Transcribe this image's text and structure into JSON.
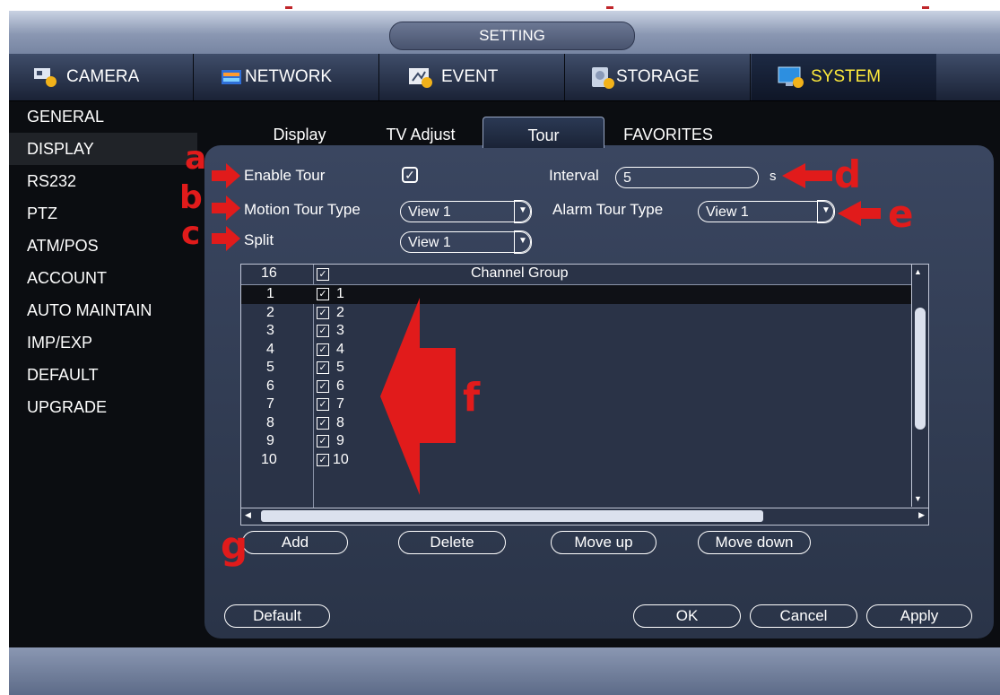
{
  "window": {
    "title": "SETTING"
  },
  "main_tabs": [
    {
      "label": "CAMERA",
      "icon": "camera-settings-icon"
    },
    {
      "label": "NETWORK",
      "icon": "network-icon"
    },
    {
      "label": "EVENT",
      "icon": "event-icon"
    },
    {
      "label": "STORAGE",
      "icon": "storage-icon"
    },
    {
      "label": "SYSTEM",
      "icon": "system-monitor-icon",
      "active": true
    }
  ],
  "sidebar": {
    "items": [
      "GENERAL",
      "DISPLAY",
      "RS232",
      "PTZ",
      "ATM/POS",
      "ACCOUNT",
      "AUTO MAINTAIN",
      "IMP/EXP",
      "DEFAULT",
      "UPGRADE"
    ],
    "active": "DISPLAY"
  },
  "sub_tabs": [
    "Display",
    "TV Adjust",
    "Tour",
    "FAVORITES"
  ],
  "active_sub_tab": "Tour",
  "form": {
    "enable_tour_label": "Enable Tour",
    "enable_tour_checked": true,
    "interval_label": "Interval",
    "interval_value": "5",
    "interval_unit": "s",
    "motion_tour_type_label": "Motion Tour Type",
    "motion_tour_type_value": "View 1",
    "alarm_tour_type_label": "Alarm Tour Type",
    "alarm_tour_type_value": "View 1",
    "split_label": "Split",
    "split_value": "View 1"
  },
  "table": {
    "header": {
      "count": "16",
      "column": "Channel Group"
    },
    "rows": [
      {
        "num": "1",
        "group": "1"
      },
      {
        "num": "2",
        "group": "2"
      },
      {
        "num": "3",
        "group": "3"
      },
      {
        "num": "4",
        "group": "4"
      },
      {
        "num": "5",
        "group": "5"
      },
      {
        "num": "6",
        "group": "6"
      },
      {
        "num": "7",
        "group": "7"
      },
      {
        "num": "8",
        "group": "8"
      },
      {
        "num": "9",
        "group": "9"
      },
      {
        "num": "10",
        "group": "10"
      }
    ]
  },
  "list_buttons": {
    "add": "Add",
    "delete": "Delete",
    "move_up": "Move up",
    "move_down": "Move down"
  },
  "footer_buttons": {
    "default": "Default",
    "ok": "OK",
    "cancel": "Cancel",
    "apply": "Apply"
  },
  "annotations": {
    "a": "a",
    "b": "b",
    "c": "c",
    "d": "d",
    "e": "e",
    "f": "f",
    "g": "g"
  },
  "colors": {
    "annotation": "#e11b1b",
    "active_tab_text": "#ffeb3b"
  }
}
